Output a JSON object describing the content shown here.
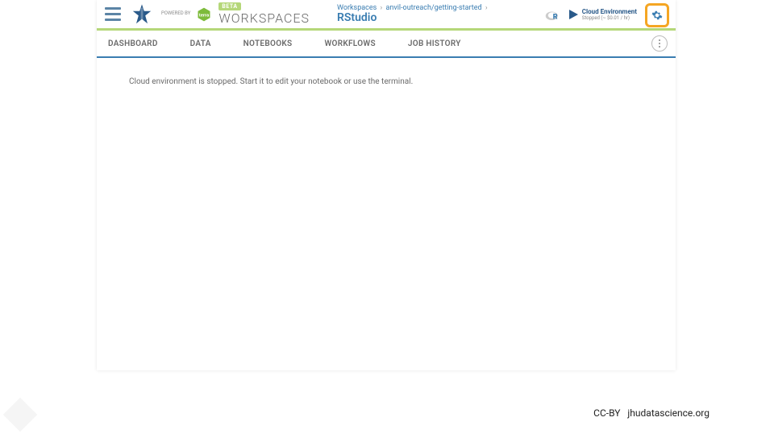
{
  "header": {
    "powered_by": "Powered by",
    "beta_label": "BETA",
    "workspaces_label": "WORKSPACES",
    "breadcrumb": {
      "root": "Workspaces",
      "path": "anvil-outreach/getting-started",
      "current": "RStudio",
      "separator": "›"
    },
    "cloud_env": {
      "title": "Cloud Environment",
      "status": "Stopped (~ $0.01 / hr)"
    }
  },
  "tabs": {
    "dashboard": "DASHBOARD",
    "data": "DATA",
    "notebooks": "NOTEBOOKS",
    "workflows": "WORKFLOWS",
    "job_history": "JOB HISTORY"
  },
  "content": {
    "message": "Cloud environment is stopped. Start it to edit your notebook or use the terminal."
  },
  "footer": {
    "license": "CC-BY",
    "site": "jhudatascience.org"
  },
  "colors": {
    "accent_blue": "#3a7db1",
    "accent_green": "#b5d779",
    "highlight_orange": "#f5a623"
  }
}
